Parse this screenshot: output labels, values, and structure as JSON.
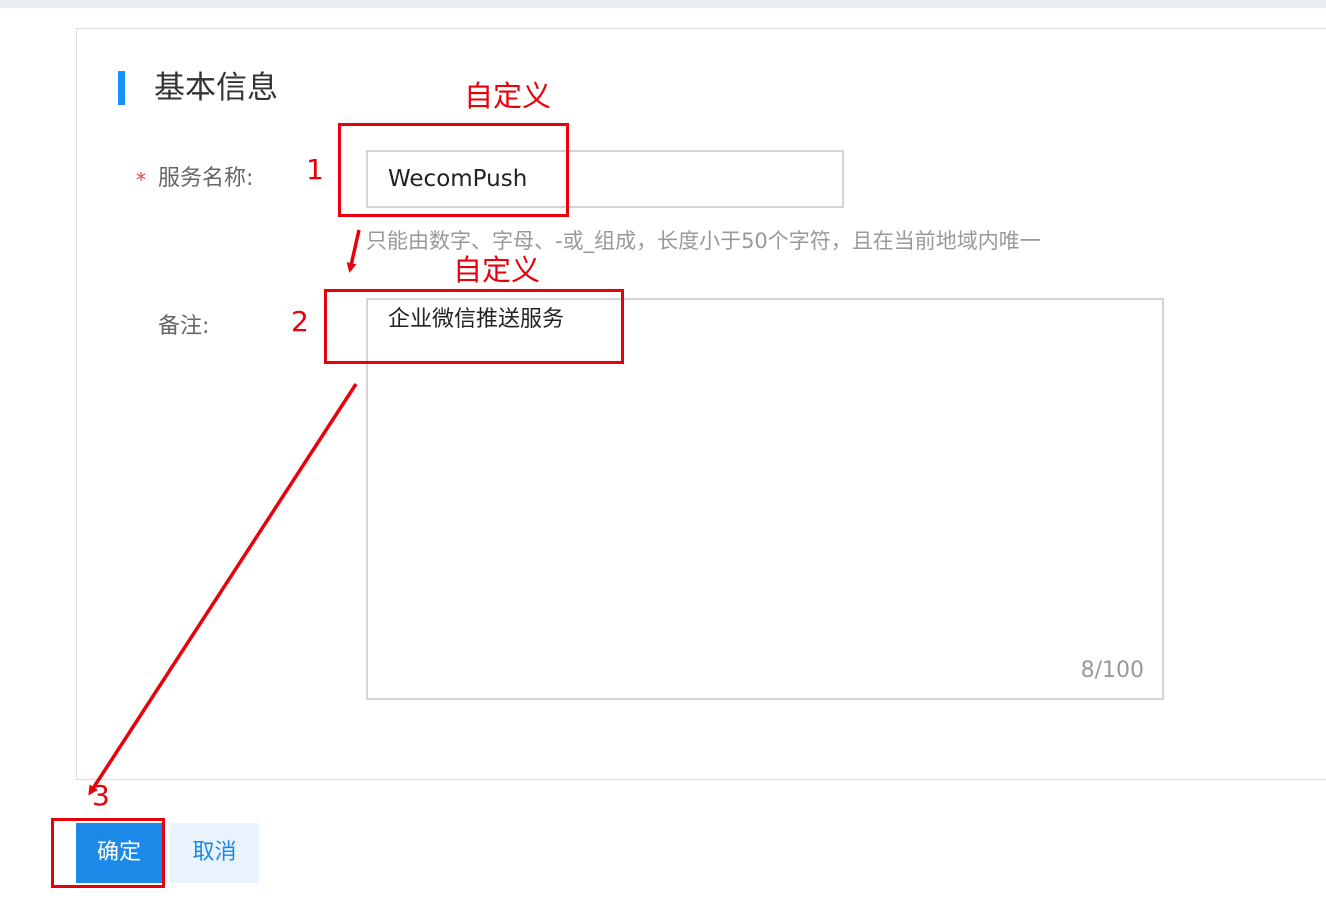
{
  "section": {
    "title": "基本信息"
  },
  "form": {
    "service_name": {
      "required_mark": "*",
      "label": "服务名称:",
      "value": "WecomPush",
      "hint": "只能由数字、字母、-或_组成，长度小于50个字符，且在当前地域内唯一"
    },
    "remark": {
      "label": "备注:",
      "value": "企业微信推送服务",
      "counter": "8/100"
    }
  },
  "actions": {
    "confirm_label": "确定",
    "cancel_label": "取消"
  },
  "annotations": {
    "color": "#e8000b",
    "step1_note": "自定义",
    "step1_num": "1",
    "step2_note": "自定义",
    "step2_num": "2",
    "step3_num": "3"
  },
  "colors": {
    "accent": "#1890ff",
    "primary_button": "#1b89e8",
    "required": "#e54545"
  }
}
